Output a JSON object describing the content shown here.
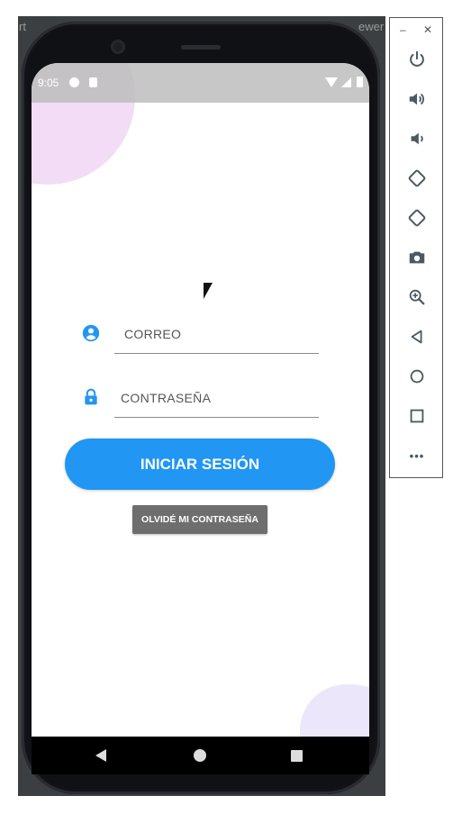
{
  "host": {
    "left_fragment": "rt",
    "right_fragment": "ewer"
  },
  "status_bar": {
    "time": "9:05"
  },
  "form": {
    "email_placeholder": "CORREO",
    "password_placeholder": "CONTRASEÑA",
    "login_label": "INICIAR SESIÓN",
    "forgot_label": "OLVIDÉ MI CONTRASEÑA"
  },
  "emulator_toolbar": {
    "minimize": "–",
    "close": "✕",
    "more": "•••",
    "buttons": [
      "power-icon",
      "volume-up-icon",
      "volume-down-icon",
      "rotate-left-icon",
      "rotate-right-icon",
      "camera-icon",
      "zoom-icon",
      "back-icon",
      "home-icon",
      "overview-icon",
      "more-icon"
    ]
  },
  "colors": {
    "accent": "#2196f3",
    "status_bar": "#bdbdbd",
    "forgot_button": "#6e6e6e"
  }
}
